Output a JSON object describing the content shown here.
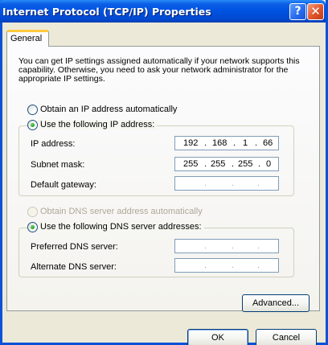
{
  "window": {
    "title": "Internet Protocol (TCP/IP) Properties",
    "help_glyph": "?",
    "close_glyph": "✕"
  },
  "tabs": [
    {
      "label": "General"
    }
  ],
  "intro_text": "You can get IP settings assigned automatically if your network supports this capability. Otherwise, you need to ask your network administrator for the appropriate IP settings.",
  "ip_section": {
    "auto_option": "Obtain an IP address automatically",
    "manual_option": "Use the following IP address:",
    "selected": "manual",
    "fields": [
      {
        "label": "IP address:",
        "octets": [
          "192",
          "168",
          "1",
          "66"
        ]
      },
      {
        "label": "Subnet mask:",
        "octets": [
          "255",
          "255",
          "255",
          "0"
        ]
      },
      {
        "label": "Default gateway:",
        "octets": [
          "",
          "",
          "",
          ""
        ]
      }
    ]
  },
  "dns_section": {
    "auto_option": "Obtain DNS server address automatically",
    "manual_option": "Use the following DNS server addresses:",
    "selected": "manual",
    "fields": [
      {
        "label": "Preferred DNS server:",
        "octets": [
          "",
          "",
          "",
          ""
        ]
      },
      {
        "label": "Alternate DNS server:",
        "octets": [
          "",
          "",
          "",
          ""
        ]
      }
    ]
  },
  "buttons": {
    "advanced": "Advanced...",
    "ok": "OK",
    "cancel": "Cancel"
  },
  "colors": {
    "titlebar": "#0054e3",
    "frame": "#0a52d8",
    "face": "#ece9d8",
    "tab_highlight": "#ffc83c"
  }
}
